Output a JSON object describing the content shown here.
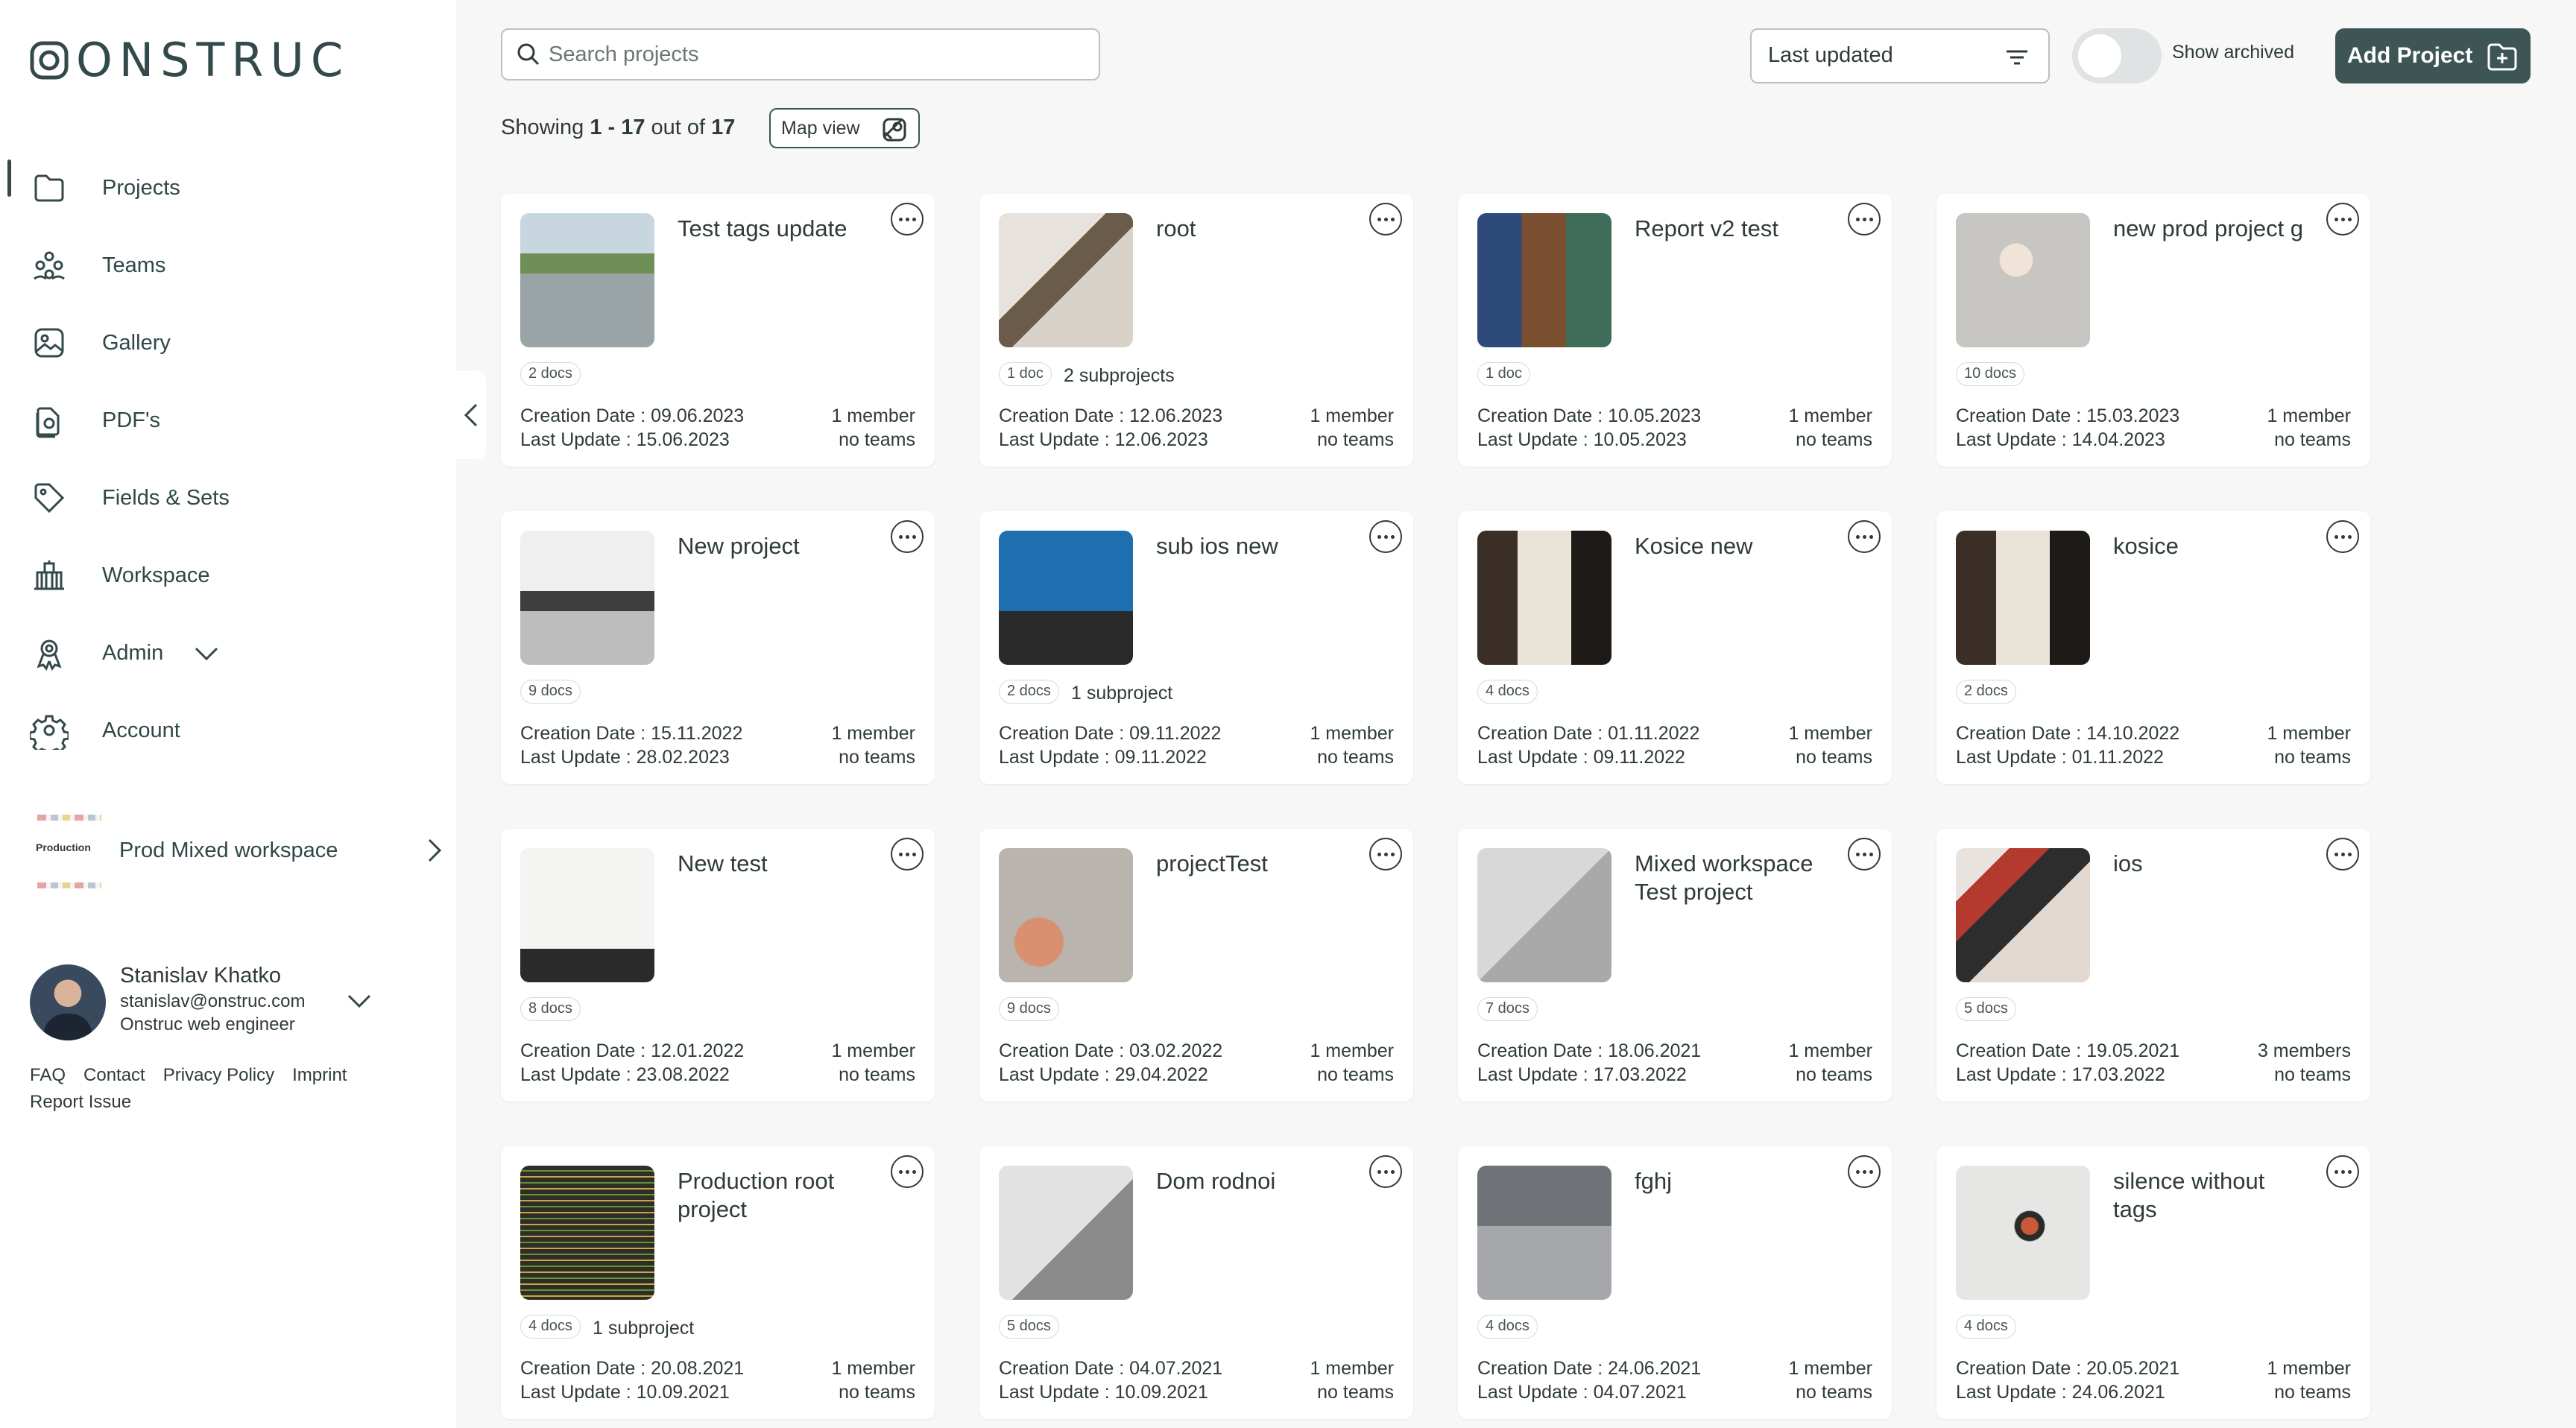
{
  "app": {
    "logo_text": "ONSTRUC"
  },
  "sidebar": {
    "items": [
      {
        "label": "Projects",
        "icon": "folder-icon",
        "active": true
      },
      {
        "label": "Teams",
        "icon": "teams-icon"
      },
      {
        "label": "Gallery",
        "icon": "gallery-icon"
      },
      {
        "label": "PDF's",
        "icon": "pdf-icon"
      },
      {
        "label": "Fields & Sets",
        "icon": "tag-icon"
      },
      {
        "label": "Workspace",
        "icon": "building-icon"
      },
      {
        "label": "Admin",
        "icon": "admin-icon"
      },
      {
        "label": "Account",
        "icon": "gear-icon"
      }
    ],
    "workspace": {
      "tag": "Production",
      "name": "Prod Mixed workspace"
    },
    "user": {
      "name": "Stanislav Khatko",
      "email": "stanislav@onstruc.com",
      "role": "Onstruc web engineer"
    },
    "footer": {
      "faq": "FAQ",
      "contact": "Contact",
      "privacy": "Privacy Policy",
      "imprint": "Imprint",
      "report": "Report Issue"
    }
  },
  "toolbar": {
    "search_placeholder": "Search projects",
    "sort_label": "Last updated",
    "archived_label": "Show archived",
    "archived_on": false,
    "add_label": "Add Project",
    "showing_prefix": "Showing",
    "showing_range": "1 - 17",
    "showing_mid": "out of",
    "showing_total": "17",
    "map_label": "Map view"
  },
  "colors": {
    "accent": "#3e5556",
    "text": "#2f3a3a",
    "background": "#f7f7f7"
  },
  "cards": [
    {
      "title": "Test tags update",
      "docs": "2 docs",
      "sub": "",
      "created": "Creation Date : 09.06.2023",
      "updated": "Last Update : 15.06.2023",
      "members": "1 member",
      "teams": "no teams",
      "thumb": "street"
    },
    {
      "title": "root",
      "docs": "1 doc",
      "sub": "2 subprojects",
      "created": "Creation Date : 12.06.2023",
      "updated": "Last Update : 12.06.2023",
      "members": "1 member",
      "teams": "no teams",
      "thumb": "kitchen"
    },
    {
      "title": "Report v2 test",
      "docs": "1 doc",
      "sub": "",
      "created": "Creation Date : 10.05.2023",
      "updated": "Last Update : 10.05.2023",
      "members": "1 member",
      "teams": "no teams",
      "thumb": "video"
    },
    {
      "title": "new prod project g",
      "docs": "10 docs",
      "sub": "",
      "created": "Creation Date : 15.03.2023",
      "updated": "Last Update : 14.04.2023",
      "members": "1 member",
      "teams": "no teams",
      "thumb": "lamp"
    },
    {
      "title": "New project",
      "docs": "9 docs",
      "sub": "",
      "created": "Creation Date : 15.11.2022",
      "updated": "Last Update : 28.02.2023",
      "members": "1 member",
      "teams": "no teams",
      "thumb": "laptop"
    },
    {
      "title": "sub ios new",
      "docs": "2 docs",
      "sub": "1 subproject",
      "created": "Creation Date : 09.11.2022",
      "updated": "Last Update : 09.11.2022",
      "members": "1 member",
      "teams": "no teams",
      "thumb": "screen"
    },
    {
      "title": "Kosice new",
      "docs": "4 docs",
      "sub": "",
      "created": "Creation Date : 01.11.2022",
      "updated": "Last Update : 09.11.2022",
      "members": "1 member",
      "teams": "no teams",
      "thumb": "door"
    },
    {
      "title": "kosice",
      "docs": "2 docs",
      "sub": "",
      "created": "Creation Date : 14.10.2022",
      "updated": "Last Update : 01.11.2022",
      "members": "1 member",
      "teams": "no teams",
      "thumb": "door"
    },
    {
      "title": "New test",
      "docs": "8 docs",
      "sub": "",
      "created": "Creation Date : 12.01.2022",
      "updated": "Last Update : 23.08.2022",
      "members": "1 member",
      "teams": "no teams",
      "thumb": "monitor"
    },
    {
      "title": "projectTest",
      "docs": "9 docs",
      "sub": "",
      "created": "Creation Date : 03.02.2022",
      "updated": "Last Update : 29.04.2022",
      "members": "1 member",
      "teams": "no teams",
      "thumb": "blur"
    },
    {
      "title": "Mixed workspace Test project",
      "docs": "7 docs",
      "sub": "",
      "created": "Creation Date : 18.06.2021",
      "updated": "Last Update : 17.03.2022",
      "members": "1 member",
      "teams": "no teams",
      "thumb": "grey"
    },
    {
      "title": "ios",
      "docs": "5 docs",
      "sub": "",
      "created": "Creation Date : 19.05.2021",
      "updated": "Last Update : 17.03.2022",
      "members": "3 members",
      "teams": "no teams",
      "thumb": "rug"
    },
    {
      "title": "Production root project",
      "docs": "4 docs",
      "sub": "1 subproject",
      "created": "Creation Date : 20.08.2021",
      "updated": "Last Update : 10.09.2021",
      "members": "1 member",
      "teams": "no teams",
      "thumb": "code"
    },
    {
      "title": "Dom rodnoi",
      "docs": "5 docs",
      "sub": "",
      "created": "Creation Date : 04.07.2021",
      "updated": "Last Update : 10.09.2021",
      "members": "1 member",
      "teams": "no teams",
      "thumb": "wall"
    },
    {
      "title": "fghj",
      "docs": "4 docs",
      "sub": "",
      "created": "Creation Date : 24.06.2021",
      "updated": "Last Update : 04.07.2021",
      "members": "1 member",
      "teams": "no teams",
      "thumb": "room"
    },
    {
      "title": "silence without tags",
      "docs": "4 docs",
      "sub": "",
      "created": "Creation Date : 20.05.2021",
      "updated": "Last Update : 24.06.2021",
      "members": "1 member",
      "teams": "no teams",
      "thumb": "desk"
    }
  ]
}
